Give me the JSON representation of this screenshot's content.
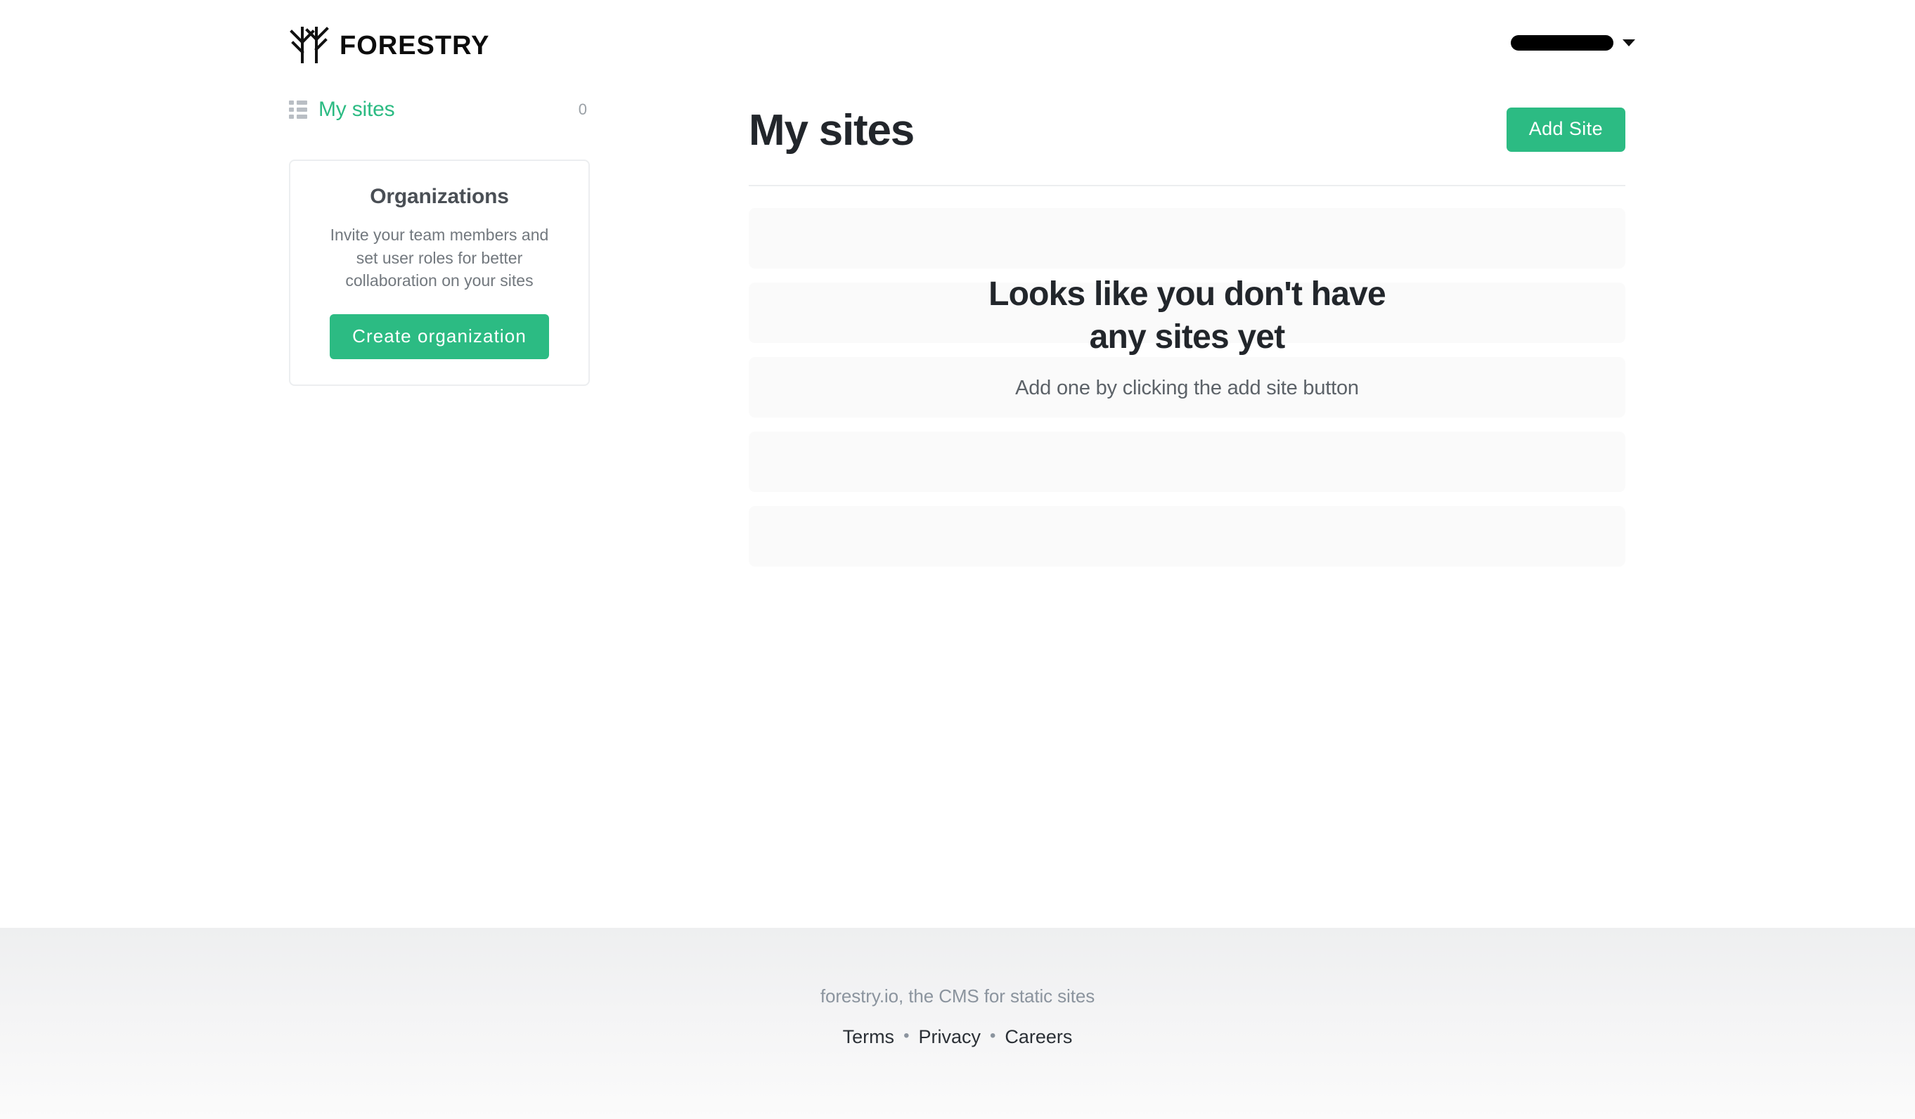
{
  "header": {
    "brand_name": "FORESTRY",
    "brand_mark": "forestry-tree-logo",
    "user_menu": {
      "display_name": "",
      "redacted": true,
      "caret_icon": "chevron-down-icon"
    }
  },
  "sidebar": {
    "nav_items": [
      {
        "label": "My sites",
        "count": "0",
        "icon": "list-icon",
        "active": true
      }
    ],
    "organizations_card": {
      "title": "Organizations",
      "description": "Invite your team members and set user roles for better collaboration on your sites",
      "cta_label": "Create organization"
    }
  },
  "main": {
    "title": "My sites",
    "add_site_label": "Add Site",
    "empty_state": {
      "title": "Looks like you don't have any sites yet",
      "subtitle": "Add one by clicking the add site button"
    },
    "skeleton_row_count": 5
  },
  "footer": {
    "tagline": "forestry.io, the CMS for static sites",
    "links": [
      {
        "label": "Terms"
      },
      {
        "label": "Privacy"
      },
      {
        "label": "Careers"
      }
    ],
    "separator": "•"
  },
  "colors": {
    "brand_green": "#2cbb83",
    "title_dark": "#22262b",
    "muted_text": "#72787e",
    "skeleton": "#fafafa",
    "divider": "#eceef0"
  }
}
